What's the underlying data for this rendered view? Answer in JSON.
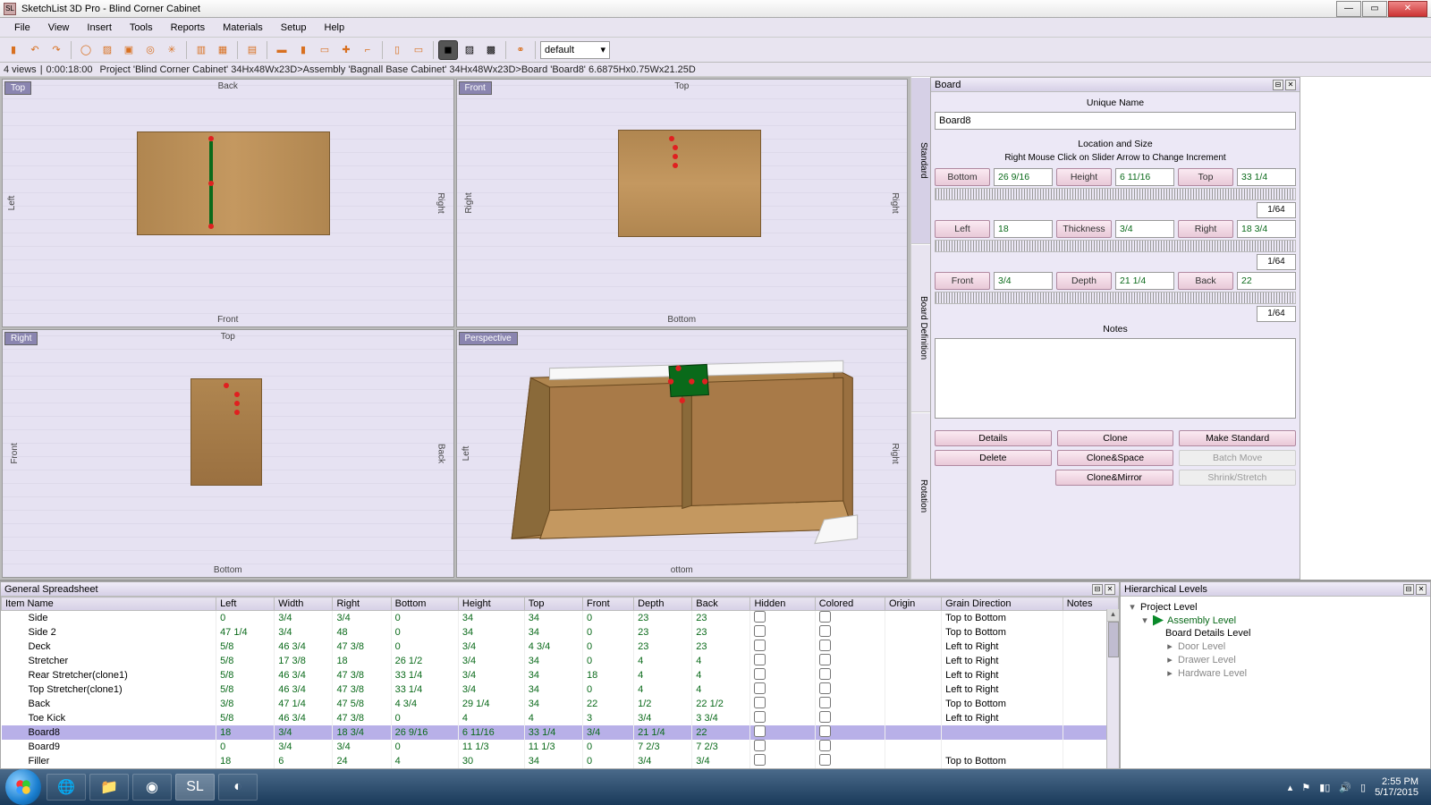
{
  "window": {
    "title": "SketchList 3D Pro - Blind Corner Cabinet"
  },
  "menu": [
    "File",
    "View",
    "Insert",
    "Tools",
    "Reports",
    "Materials",
    "Setup",
    "Help"
  ],
  "toolbar_select": "default",
  "breadcrumb": {
    "views": "4 views",
    "time": "0:00:18:00",
    "project": "Project 'Blind Corner Cabinet' 34Hx48Wx23D",
    "assembly": "Assembly 'Bagnall Base Cabinet' 34Hx48Wx23D",
    "board": "Board 'Board8' 6.6875Hx0.75Wx21.25D"
  },
  "viewports": [
    {
      "label": "Top",
      "top": "Back",
      "bottom": "Front",
      "left": "Left",
      "right": "Right"
    },
    {
      "label": "Front",
      "top": "Top",
      "bottom": "Bottom",
      "left": "Right",
      "right": "Right"
    },
    {
      "label": "Right",
      "top": "Top",
      "bottom": "Bottom",
      "left": "Front",
      "right": "Back"
    },
    {
      "label": "Perspective",
      "top": "",
      "bottom": "ottom",
      "left": "Left",
      "right": "Right"
    }
  ],
  "side_tabs": [
    "Standard",
    "Board Definition",
    "Rotation"
  ],
  "board_panel": {
    "title": "Board",
    "unique_name_hd": "Unique Name",
    "unique_name": "Board8",
    "loc_size_hd": "Location and Size",
    "hint": "Right Mouse Click on Slider Arrow to Change Increment",
    "rows": [
      {
        "a": "Bottom",
        "av": "26 9/16",
        "b": "Height",
        "bv": "6 11/16",
        "c": "Top",
        "cv": "33 1/4",
        "inc": "1/64"
      },
      {
        "a": "Left",
        "av": "18",
        "b": "Thickness",
        "bv": "3/4",
        "c": "Right",
        "cv": "18 3/4",
        "inc": "1/64"
      },
      {
        "a": "Front",
        "av": "3/4",
        "b": "Depth",
        "bv": "21 1/4",
        "c": "Back",
        "cv": "22",
        "inc": "1/64"
      }
    ],
    "notes_hd": "Notes",
    "buttons": {
      "details": "Details",
      "clone": "Clone",
      "make_standard": "Make Standard",
      "delete": "Delete",
      "clone_space": "Clone&Space",
      "batch_move": "Batch Move",
      "clone_mirror": "Clone&Mirror",
      "shrink_stretch": "Shrink/Stretch"
    }
  },
  "spreadsheet": {
    "title": "General Spreadsheet",
    "headers": [
      "Item Name",
      "Left",
      "Width",
      "Right",
      "Bottom",
      "Height",
      "Top",
      "Front",
      "Depth",
      "Back",
      "Hidden",
      "Colored",
      "Origin",
      "Grain Direction",
      "Notes"
    ],
    "rows": [
      {
        "n": "Side",
        "v": [
          "0",
          "3/4",
          "3/4",
          "0",
          "34",
          "34",
          "0",
          "23",
          "23"
        ],
        "g": "Top to Bottom"
      },
      {
        "n": "Side 2",
        "v": [
          "47 1/4",
          "3/4",
          "48",
          "0",
          "34",
          "34",
          "0",
          "23",
          "23"
        ],
        "g": "Top to Bottom"
      },
      {
        "n": "Deck",
        "v": [
          "5/8",
          "46 3/4",
          "47 3/8",
          "0",
          "3/4",
          "4 3/4",
          "0",
          "23",
          "23"
        ],
        "g": "Left to Right"
      },
      {
        "n": "Stretcher",
        "v": [
          "5/8",
          "17 3/8",
          "18",
          "26 1/2",
          "3/4",
          "34",
          "0",
          "4",
          "4"
        ],
        "g": "Left to Right"
      },
      {
        "n": "Rear Stretcher(clone1)",
        "v": [
          "5/8",
          "46 3/4",
          "47 3/8",
          "33 1/4",
          "3/4",
          "34",
          "18",
          "4",
          "4"
        ],
        "g": "Left to Right"
      },
      {
        "n": "Top Stretcher(clone1)",
        "v": [
          "5/8",
          "46 3/4",
          "47 3/8",
          "33 1/4",
          "3/4",
          "34",
          "0",
          "4",
          "4"
        ],
        "g": "Left to Right"
      },
      {
        "n": "Back",
        "v": [
          "3/8",
          "47 1/4",
          "47 5/8",
          "4 3/4",
          "29 1/4",
          "34",
          "22",
          "1/2",
          "22 1/2"
        ],
        "g": "Top to Bottom"
      },
      {
        "n": "Toe Kick",
        "v": [
          "5/8",
          "46 3/4",
          "47 3/8",
          "0",
          "4",
          "4",
          "3",
          "3/4",
          "3 3/4"
        ],
        "g": "Left to Right"
      },
      {
        "n": "Board8",
        "v": [
          "18",
          "3/4",
          "18 3/4",
          "26 9/16",
          "6 11/16",
          "33 1/4",
          "3/4",
          "21 1/4",
          "22"
        ],
        "g": "",
        "sel": true
      },
      {
        "n": "Board9",
        "v": [
          "0",
          "3/4",
          "3/4",
          "0",
          "11 1/3",
          "11 1/3",
          "0",
          "7 2/3",
          "7 2/3"
        ],
        "g": ""
      },
      {
        "n": "Filler",
        "v": [
          "18",
          "6",
          "24",
          "4",
          "30",
          "34",
          "0",
          "3/4",
          "3/4"
        ],
        "g": "Top to Bottom"
      }
    ]
  },
  "hier": {
    "title": "Hierarchical Levels",
    "items": {
      "project": "Project Level",
      "assembly": "Assembly Level",
      "board": "Board Details Level",
      "door": "Door Level",
      "drawer": "Drawer Level",
      "hardware": "Hardware Level"
    }
  },
  "tray": {
    "time": "2:55 PM",
    "date": "5/17/2015"
  }
}
